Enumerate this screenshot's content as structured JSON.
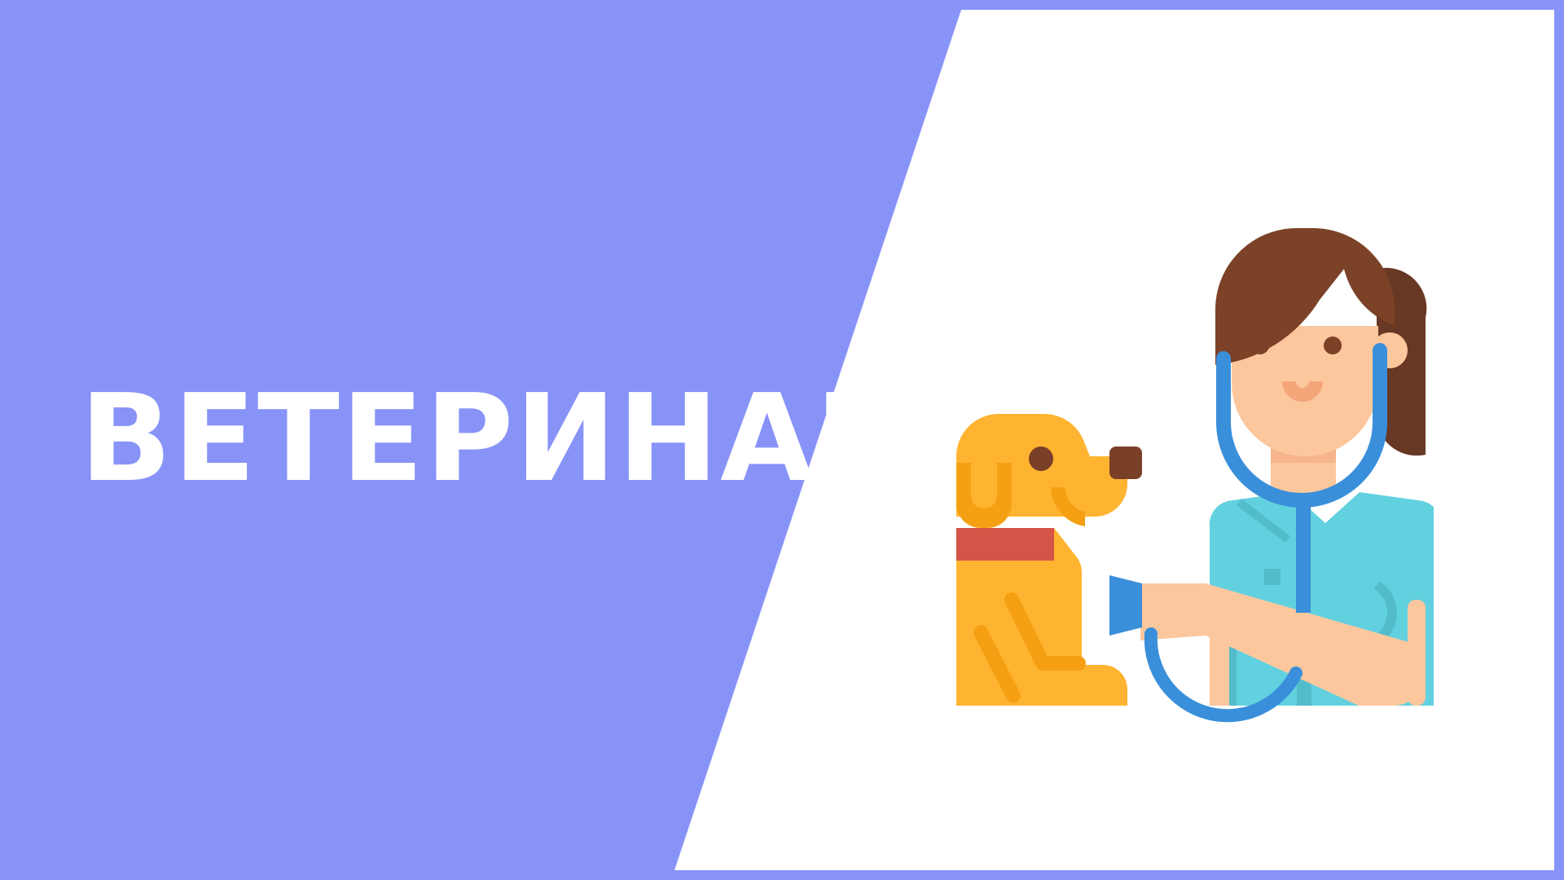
{
  "banner": {
    "title": "ВЕТЕРИНАР"
  },
  "illustration": {
    "icon": "veterinarian-with-dog-icon",
    "colors": {
      "background": "#8893f8",
      "panel": "#ffffff",
      "dog": "#ffb431",
      "dog_shade": "#f5a012",
      "collar": "#d65348",
      "nose": "#7a3f27",
      "hair": "#7b4228",
      "hair_dark": "#673823",
      "skin": "#fdc79e",
      "scrubs": "#62d1df",
      "scrubs_shade": "#52bccb",
      "stethoscope": "#3a8fda"
    }
  }
}
